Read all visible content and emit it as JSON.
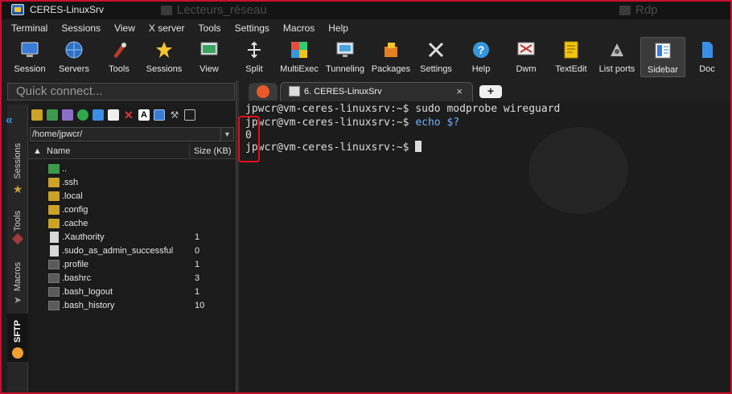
{
  "window": {
    "title": "CERES-LinuxSrv",
    "ghost_tabs": [
      "Lecteurs_réseau",
      "Rdp"
    ]
  },
  "menu": [
    "Terminal",
    "Sessions",
    "View",
    "X server",
    "Tools",
    "Settings",
    "Macros",
    "Help"
  ],
  "toolbar": [
    {
      "label": "Session",
      "icon": "session-icon",
      "color": "#3a7bd5"
    },
    {
      "label": "Servers",
      "icon": "servers-icon",
      "color": "#2e6fc4"
    },
    {
      "label": "Tools",
      "icon": "tools-icon",
      "color": "#c0392b"
    },
    {
      "label": "Sessions",
      "icon": "star-icon",
      "color": "#f4c430"
    },
    {
      "label": "View",
      "icon": "view-icon",
      "color": "#3aa55d"
    },
    {
      "label": "Split",
      "icon": "split-icon",
      "color": "#e0e0e0"
    },
    {
      "label": "MultiExec",
      "icon": "multiexec-icon",
      "color": "#e74c3c"
    },
    {
      "label": "Tunneling",
      "icon": "tunneling-icon",
      "color": "#4aa3df"
    },
    {
      "label": "Packages",
      "icon": "packages-icon",
      "color": "#e67e22"
    },
    {
      "label": "Settings",
      "icon": "settings-icon",
      "color": "#dddddd"
    },
    {
      "label": "Help",
      "icon": "help-icon",
      "color": "#3498db"
    },
    {
      "label": "Dwm",
      "icon": "dwm-icon",
      "color": "#8e44ad"
    },
    {
      "label": "TextEdit",
      "icon": "textedit-icon",
      "color": "#f1c40f"
    },
    {
      "label": "List ports",
      "icon": "listports-icon",
      "color": "#bbbbbb"
    },
    {
      "label": "Sidebar",
      "icon": "sidebar-icon",
      "color": "#ffffff"
    },
    {
      "label": "Doc",
      "icon": "doc-icon",
      "color": "#3a8ee6"
    }
  ],
  "quick_connect": {
    "placeholder": "Quick connect..."
  },
  "side_tabs": {
    "sessions": "Sessions",
    "tools": "Tools",
    "macros": "Macros",
    "sftp": "SFTP"
  },
  "sftp": {
    "path": "/home/jpwcr/",
    "columns": {
      "name": "Name",
      "size": "Size (KB)"
    },
    "files": [
      {
        "name": "..",
        "size": "",
        "type": "up"
      },
      {
        "name": ".ssh",
        "size": "",
        "type": "folder"
      },
      {
        "name": ".local",
        "size": "",
        "type": "folder"
      },
      {
        "name": ".config",
        "size": "",
        "type": "folder"
      },
      {
        "name": ".cache",
        "size": "",
        "type": "folder"
      },
      {
        "name": ".Xauthority",
        "size": "1",
        "type": "doc"
      },
      {
        "name": ".sudo_as_admin_successful",
        "size": "0",
        "type": "doc"
      },
      {
        "name": ".profile",
        "size": "1",
        "type": "file"
      },
      {
        "name": ".bashrc",
        "size": "3",
        "type": "file"
      },
      {
        "name": ".bash_logout",
        "size": "1",
        "type": "file"
      },
      {
        "name": ".bash_history",
        "size": "10",
        "type": "file"
      }
    ]
  },
  "tabs": {
    "session_tab": "6. CERES-LinuxSrv",
    "close": "×",
    "new": "+"
  },
  "terminal": {
    "lines": [
      {
        "prompt": "jpwcr@vm-ceres-linuxsrv:~$ ",
        "cmd": "sudo modprobe wireguard",
        "highlight": false
      },
      {
        "prompt": "jpwcr@vm-ceres-linuxsrv:~$ ",
        "cmd": "echo $?",
        "highlight": true
      },
      {
        "prompt": "0",
        "cmd": "",
        "highlight": false
      },
      {
        "prompt": "jpwcr@vm-ceres-linuxsrv:~$ ",
        "cmd": "",
        "highlight": false
      }
    ]
  }
}
